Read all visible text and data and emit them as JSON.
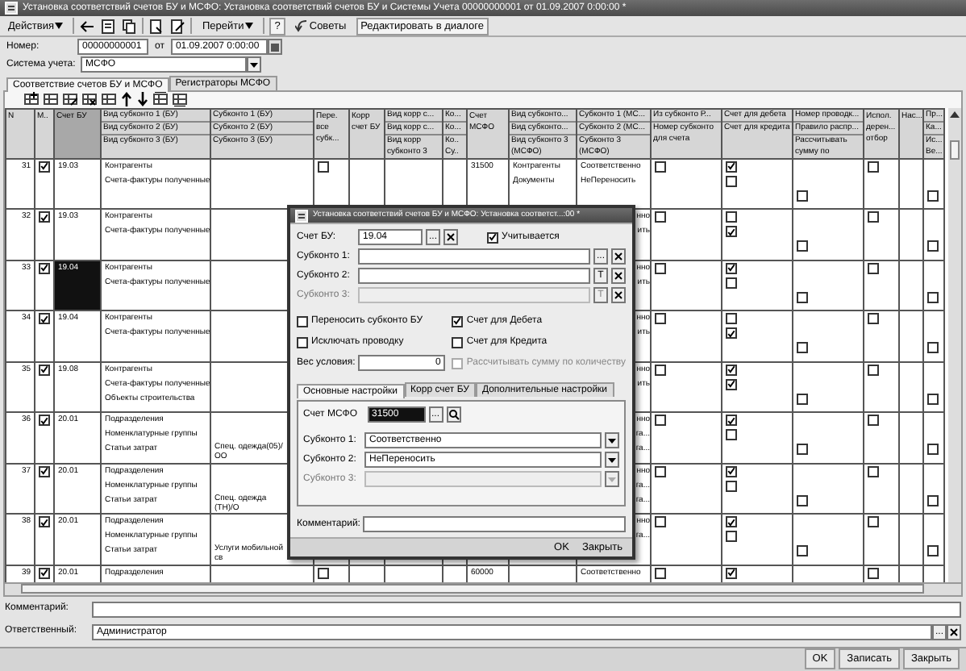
{
  "window": {
    "title": "Установка соответствий счетов БУ и МСФО: Установка соответствий счетов БУ и Системы Учета 00000000001 от 01.09.2007 0:00:00 *"
  },
  "toolbar": {
    "actions": "Действия",
    "goto": "Перейти",
    "help": "?",
    "tips": "Советы",
    "edit_in_dialog": "Редактировать в диалоге"
  },
  "header": {
    "number_label": "Номер:",
    "number": "00000000001",
    "date_label": "от",
    "date": "01.09.2007 0:00:00",
    "system_label": "Система учета:",
    "system": "МСФО"
  },
  "tabs": [
    {
      "label": "Соответствие счетов БУ и МСФО",
      "selected": true
    },
    {
      "label": "Регистраторы МСФО",
      "selected": false
    }
  ],
  "table": {
    "columns": [
      {
        "lines": [
          "N"
        ],
        "selected": false
      },
      {
        "lines": [
          "М.."
        ],
        "selected": false
      },
      {
        "lines": [
          "Счет БУ"
        ],
        "selected": true
      },
      {
        "lines": [
          "Вид субконто 1 (БУ)",
          "Вид субконто 2 (БУ)",
          "Вид субконто 3 (БУ)"
        ],
        "selected": false
      },
      {
        "lines": [
          "Субконто 1 (БУ)",
          "Субконто 2 (БУ)",
          "Субконто 3 (БУ)"
        ],
        "selected": false
      },
      {
        "lines": [
          "Пере. все субк..."
        ],
        "selected": false
      },
      {
        "lines": [
          "Корр счет БУ"
        ],
        "selected": false
      },
      {
        "lines": [
          "Вид корр с...",
          "Вид корр с...",
          "Вид корр субконто 3"
        ],
        "selected": false
      },
      {
        "lines": [
          "Ко...",
          "Ко...",
          "Ко.. Су.."
        ],
        "selected": false
      },
      {
        "lines": [
          "Счет МСФО"
        ],
        "selected": false
      },
      {
        "lines": [
          "Вид субконто...",
          "Вид субконто...",
          "Вид субконто 3 (МСФО)"
        ],
        "selected": false
      },
      {
        "lines": [
          "Субконто 1 (МС...",
          "Субконто 2 (МС...",
          "Субконто 3 (МСФО)"
        ],
        "selected": false
      },
      {
        "lines": [
          "Из субконто Р...",
          "Номер субконто для счета"
        ],
        "selected": false
      },
      {
        "lines": [
          "Счет для дебета",
          "Счет для кредита"
        ],
        "selected": false
      },
      {
        "lines": [
          "Номер проводк...",
          "Правило распр...",
          "Рассчитывать сумму по"
        ],
        "selected": false
      },
      {
        "lines": [
          "Испол. дерен... отбор"
        ],
        "selected": false
      },
      {
        "lines": [
          "Нас..."
        ],
        "selected": false
      },
      {
        "lines": [
          "Пр...",
          "Ка...",
          "Ис... Ве..."
        ],
        "selected": false
      }
    ],
    "rows": [
      {
        "kind": "full",
        "n": "31",
        "marked": true,
        "account": "19.03",
        "account_selected": false,
        "kinds_bu": [
          "Контрагенты",
          "Счета-фактуры полученные"
        ],
        "transfer_all": false,
        "account_msfo": "31500",
        "kinds_msfo": [
          "Контрагенты",
          "Документы"
        ],
        "subconto_msfo": [
          "Соответственно",
          "НеПереносить"
        ],
        "from_subconto": false,
        "debit": true,
        "credit": false,
        "calc_by": false,
        "use_selection": false,
        "last_flag": false
      },
      {
        "kind": "covered",
        "n": "32",
        "marked": true,
        "account": "19.03",
        "account_selected": false,
        "kinds_bu": [
          "Контрагенты",
          "Счета-фактуры полученные"
        ],
        "subconto_msfo": [
          "нно",
          "ить"
        ],
        "from_subconto": false,
        "debit": false,
        "credit": true,
        "calc_by": false,
        "use_selection": false,
        "last_flag": false
      },
      {
        "kind": "covered",
        "n": "33",
        "marked": true,
        "account": "19.04",
        "account_selected": true,
        "kinds_bu": [
          "Контрагенты",
          "Счета-фактуры полученные"
        ],
        "subconto_msfo": [
          "нно",
          "ить"
        ],
        "from_subconto": false,
        "debit": true,
        "credit": false,
        "calc_by": false,
        "use_selection": false,
        "last_flag": false
      },
      {
        "kind": "covered",
        "n": "34",
        "marked": true,
        "account": "19.04",
        "account_selected": false,
        "kinds_bu": [
          "Контрагенты",
          "Счета-фактуры полученные"
        ],
        "subconto_msfo": [
          "нно",
          "ить"
        ],
        "from_subconto": false,
        "debit": false,
        "credit": true,
        "calc_by": false,
        "use_selection": false,
        "last_flag": false
      },
      {
        "kind": "covered",
        "n": "35",
        "marked": true,
        "account": "19.08",
        "account_selected": false,
        "kinds_bu": [
          "Контрагенты",
          "Счета-фактуры полученные",
          "Объекты строительства"
        ],
        "subconto_msfo": [
          "нно",
          "ить"
        ],
        "from_subconto": false,
        "debit": true,
        "credit": true,
        "calc_by": false,
        "use_selection": false,
        "last_flag": false
      },
      {
        "kind": "covered",
        "n": "36",
        "marked": true,
        "account": "20.01",
        "account_selected": false,
        "kinds_bu": [
          "Подразделения",
          "Номенклатурные группы",
          "Статьи затрат"
        ],
        "subconto_bu_3": "Спец. одежда(05)/ОО",
        "subconto_msfo": [
          "нно",
          "га...",
          "га..."
        ],
        "from_subconto": false,
        "debit": true,
        "credit": false,
        "calc_by": false,
        "use_selection": false,
        "last_flag": false
      },
      {
        "kind": "covered",
        "n": "37",
        "marked": true,
        "account": "20.01",
        "account_selected": false,
        "kinds_bu": [
          "Подразделения",
          "Номенклатурные группы",
          "Статьи затрат"
        ],
        "subconto_bu_3": "Спец. одежда (ТН)/О",
        "subconto_msfo": [
          "нно",
          "га...",
          "га..."
        ],
        "from_subconto": false,
        "debit": true,
        "credit": false,
        "calc_by": false,
        "use_selection": false,
        "last_flag": false
      },
      {
        "kind": "covered",
        "n": "38",
        "marked": true,
        "account": "20.01",
        "account_selected": false,
        "kinds_bu": [
          "Подразделения",
          "Номенклатурные группы",
          "Статьи затрат"
        ],
        "subconto_bu_3": "Услуги мобильной св",
        "subconto_msfo": [
          "нно",
          "га..."
        ],
        "from_subconto": false,
        "debit": true,
        "credit": false,
        "calc_by": false,
        "use_selection": false,
        "last_flag": false
      },
      {
        "kind": "full",
        "n": "39",
        "marked": true,
        "account": "20.01",
        "account_selected": false,
        "kinds_bu": [
          "Подразделения"
        ],
        "transfer_all": false,
        "account_msfo": "60000",
        "subconto_msfo": [
          "Соответственно"
        ],
        "from_subconto": false,
        "debit": true,
        "use_selection": false
      }
    ]
  },
  "dialog": {
    "title": "Установка соответствий счетов БУ и МСФО: Установка соответст...:00 *",
    "account_bu_label": "Счет БУ:",
    "account_bu": "19.04",
    "select_button": "...",
    "counted": {
      "label": "Учитывается",
      "checked": true
    },
    "subconto_fields": [
      {
        "label": "Субконто 1:",
        "button": "...",
        "disabled": false
      },
      {
        "label": "Субконто 2:",
        "button": "T",
        "disabled": false
      },
      {
        "label": "Субконто 3:",
        "button": "T",
        "disabled": true
      }
    ],
    "options_left": [
      {
        "label": "Переносить субконто БУ",
        "checked": false
      },
      {
        "label": "Исключать проводку",
        "checked": false
      }
    ],
    "weight_label": "Вес условия:",
    "weight": "0",
    "options_right": [
      {
        "label": "Счет для Дебета",
        "checked": true,
        "disabled": false
      },
      {
        "label": "Счет для Кредита",
        "checked": false,
        "disabled": false
      },
      {
        "label": "Рассчитывать сумму по количеству",
        "checked": false,
        "disabled": true
      }
    ],
    "tabs": [
      {
        "label": "Основные настройки",
        "selected": true
      },
      {
        "label": "Корр счет БУ",
        "selected": false
      },
      {
        "label": "Дополнительные настройки",
        "selected": false
      }
    ],
    "account_msfo_label": "Счет МСФО",
    "account_msfo": "31500",
    "account_msfo_button": "...",
    "msfo_subconto": [
      {
        "label": "Субконто 1:",
        "value": "Соответственно",
        "disabled": false
      },
      {
        "label": "Субконто 2:",
        "value": "НеПереносить",
        "disabled": false
      },
      {
        "label": "Субконто 3:",
        "disabled": true
      }
    ],
    "comment_label": "Комментарий:",
    "buttons": [
      "OK",
      "Закрыть"
    ]
  },
  "footer": {
    "comment_label": "Комментарий:",
    "responsible_label": "Ответственный:",
    "responsible": "Администратор",
    "select_button": "...",
    "buttons": [
      "OK",
      "Записать",
      "Закрыть"
    ]
  }
}
